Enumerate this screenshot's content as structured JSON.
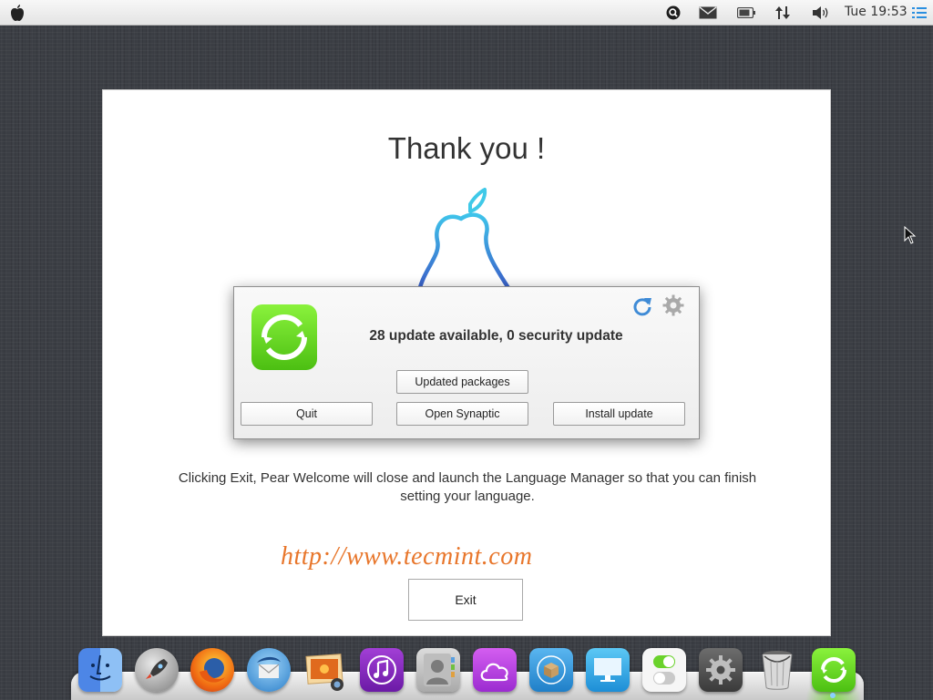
{
  "menubar": {
    "clock": "Tue 19:53",
    "tray_icons": [
      "search-icon",
      "mail-icon",
      "battery-icon",
      "network-icon",
      "volume-icon",
      "menu-list-icon"
    ]
  },
  "welcome": {
    "title": "Thank you !",
    "description": "Clicking Exit, Pear Welcome will close and launch the Language Manager so that you can finish setting your language.",
    "watermark": "http://www.tecmint.com",
    "exit_label": "Exit"
  },
  "update_dialog": {
    "message": "28 update available, 0 security update",
    "buttons": {
      "updated_packages": "Updated packages",
      "quit": "Quit",
      "open_synaptic": "Open Synaptic",
      "install_update": "Install update"
    }
  },
  "dock": {
    "items": [
      "finder",
      "launchpad",
      "firefox",
      "thunderbird",
      "photos",
      "music",
      "contacts",
      "cloud",
      "package-installer",
      "display",
      "switches",
      "system-settings",
      "trash",
      "pear-updater"
    ]
  },
  "colors": {
    "accent_green": "#6cd11f",
    "watermark_orange": "#e8762b",
    "pear_blue": "#2f8fd8"
  }
}
